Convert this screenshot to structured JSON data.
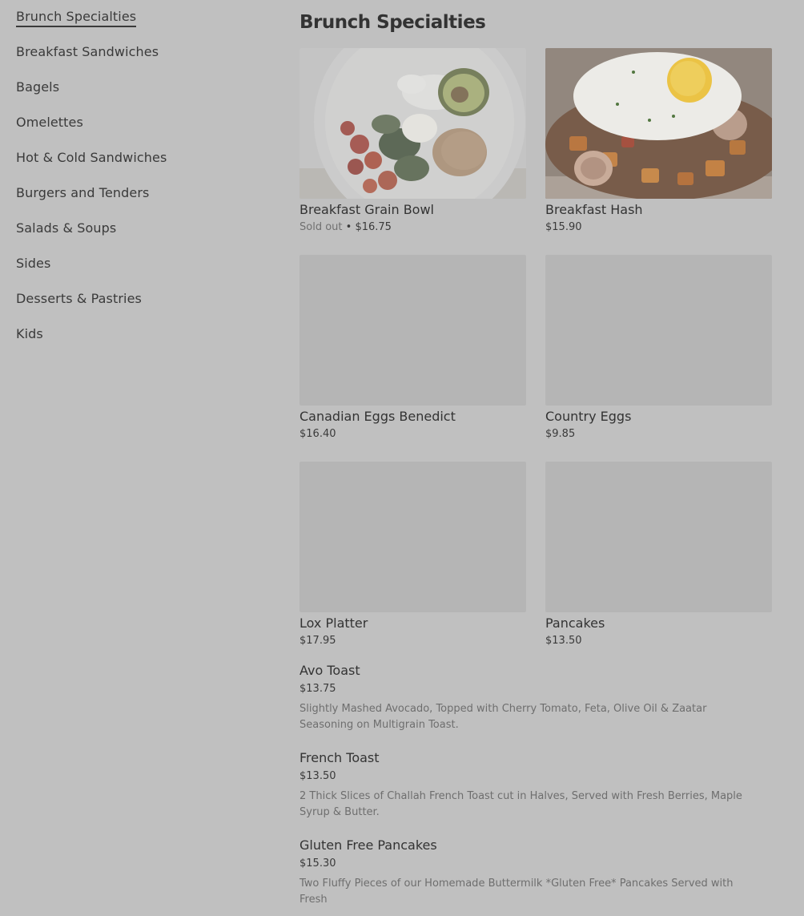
{
  "sidebar": {
    "items": [
      {
        "label": "Brunch Specialties",
        "active": true
      },
      {
        "label": "Breakfast Sandwiches"
      },
      {
        "label": "Bagels"
      },
      {
        "label": "Omelettes"
      },
      {
        "label": "Hot & Cold Sandwiches"
      },
      {
        "label": "Burgers and Tenders"
      },
      {
        "label": "Salads & Soups"
      },
      {
        "label": "Sides"
      },
      {
        "label": "Desserts & Pastries"
      },
      {
        "label": "Kids"
      }
    ]
  },
  "main": {
    "title": "Brunch Specialties",
    "cards": [
      {
        "name": "Breakfast Grain Bowl",
        "sold_out": "Sold out",
        "separator": " • ",
        "price": "$16.75",
        "image": "grain-bowl-photo"
      },
      {
        "name": "Breakfast Hash",
        "price": "$15.90",
        "image": "hash-photo"
      },
      {
        "name": "Canadian Eggs Benedict",
        "price": "$16.40",
        "image": "placeholder"
      },
      {
        "name": "Country Eggs",
        "price": "$9.85",
        "image": "placeholder"
      },
      {
        "name": "Lox Platter",
        "price": "$17.95",
        "image": "placeholder"
      },
      {
        "name": "Pancakes",
        "price": "$13.50",
        "image": "placeholder"
      }
    ],
    "list": [
      {
        "name": "Avo Toast",
        "price": "$13.75",
        "description": "Slightly Mashed Avocado, Topped with Cherry Tomato, Feta, Olive Oil & Zaatar Seasoning on Multigrain Toast."
      },
      {
        "name": "French Toast",
        "price": "$13.50",
        "description": "2 Thick Slices of Challah French Toast cut in Halves, Served with Fresh Berries, Maple Syrup & Butter."
      },
      {
        "name": "Gluten Free Pancakes",
        "price": "$15.30",
        "description": "Two Fluffy Pieces of our Homemade Buttermilk *Gluten Free* Pancakes Served with Fresh"
      }
    ]
  }
}
